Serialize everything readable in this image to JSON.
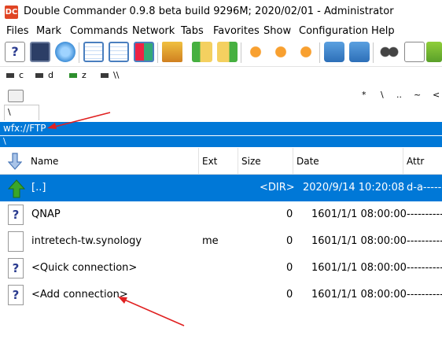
{
  "window": {
    "logo_text": "DC",
    "title": "Double Commander 0.9.8 beta build 9296M; 2020/02/01 - Administrator"
  },
  "menu": [
    "Files",
    "Mark",
    "Commands",
    "Network",
    "Tabs",
    "Favorites",
    "Show",
    "Configuration",
    "Help"
  ],
  "drives": [
    {
      "label": "c"
    },
    {
      "label": "d"
    },
    {
      "label": "z"
    },
    {
      "label": "\\\\"
    }
  ],
  "panel_buttons": [
    "*",
    "\\",
    "..",
    "~",
    "<"
  ],
  "tab": {
    "label": "\\"
  },
  "path": {
    "current": "wfx://FTP",
    "sub": "\\"
  },
  "columns": {
    "name": "Name",
    "ext": "Ext",
    "size": "Size",
    "date": "Date",
    "attr": "Attr"
  },
  "rows": [
    {
      "name": "[..]",
      "ext": "",
      "size": "<DIR>",
      "date": "2020/9/14 10:20:08",
      "attr": "d-a-------",
      "selected": true,
      "icon": "up-arrow-icon"
    },
    {
      "name": "QNAP",
      "ext": "",
      "size": "0",
      "date": "1601/1/1 08:00:00",
      "attr": "----------",
      "icon": "unknown-file-icon"
    },
    {
      "name": "intretech-tw.synology",
      "ext": "me",
      "size": "0",
      "date": "1601/1/1 08:00:00",
      "attr": "----------",
      "icon": "file-icon"
    },
    {
      "name": "<Quick connection>",
      "ext": "",
      "size": "0",
      "date": "1601/1/1 08:00:00",
      "attr": "----------",
      "icon": "unknown-file-icon"
    },
    {
      "name": "<Add connection>",
      "ext": "",
      "size": "0",
      "date": "1601/1/1 08:00:00",
      "attr": "----------",
      "icon": "unknown-file-icon"
    }
  ],
  "colors": {
    "selection": "#0078d7",
    "arrow": "#e02020",
    "up_arrow": "#3aa62a"
  }
}
